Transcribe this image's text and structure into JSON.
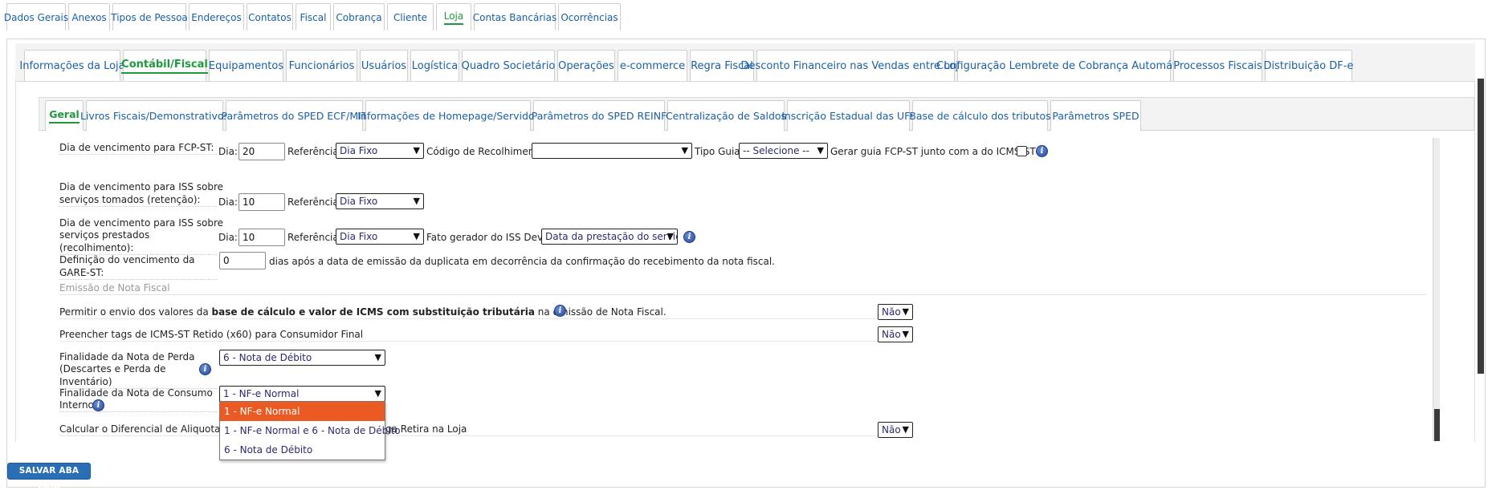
{
  "tabs_level1": [
    {
      "label": "Dados Gerais"
    },
    {
      "label": "Anexos"
    },
    {
      "label": "Tipos de Pessoa"
    },
    {
      "label": "Endereços"
    },
    {
      "label": "Contatos"
    },
    {
      "label": "Fiscal"
    },
    {
      "label": "Cobrança"
    },
    {
      "label": "Cliente"
    },
    {
      "label": "Loja",
      "active": true
    },
    {
      "label": "Contas Bancárias"
    },
    {
      "label": "Ocorrências"
    }
  ],
  "tabs_level2": [
    {
      "label": "Informações da Loja"
    },
    {
      "label": "Contábil/Fiscal",
      "active": true
    },
    {
      "label": "Equipamentos"
    },
    {
      "label": "Funcionários"
    },
    {
      "label": "Usuários"
    },
    {
      "label": "Logística"
    },
    {
      "label": "Quadro Societário"
    },
    {
      "label": "Operações"
    },
    {
      "label": "e-commerce"
    },
    {
      "label": "Regra Fiscal"
    },
    {
      "label": "Desconto Financeiro nas Vendas entre Lojas"
    },
    {
      "label": "Configuração Lembrete de Cobrança Automático"
    },
    {
      "label": "Processos Fiscais"
    },
    {
      "label": "Distribuição DF-e"
    }
  ],
  "tabs_level3": [
    {
      "label": "Geral",
      "active": true
    },
    {
      "label": "Livros Fiscais/Demonstrativos"
    },
    {
      "label": "Parâmetros do SPED ECF/MIT"
    },
    {
      "label": "Informações de Homepage/Servidor"
    },
    {
      "label": "Parâmetros do SPED REINF"
    },
    {
      "label": "Centralização de Saldos"
    },
    {
      "label": "Inscrição Estadual das UFs"
    },
    {
      "label": "Base de cálculo dos tributos"
    },
    {
      "label": "Parâmetros SPED"
    }
  ],
  "form": {
    "fcp": {
      "label": "Dia de vencimento para FCP-ST:",
      "dia_label": "Dia:",
      "dia_value": "20",
      "ref_label": "Referência:",
      "ref_value": "Dia Fixo",
      "codigo_label": "Código de Recolhimento:",
      "codigo_value": "",
      "tipo_guia_label": "Tipo Guia:",
      "tipo_guia_value": "-- Selecione --",
      "gerar_guia_label": "Gerar guia FCP-ST junto com a do ICMS-ST ?"
    },
    "iss_tomados": {
      "label_line1": "Dia de vencimento para ISS sobre",
      "label_line2": "serviços tomados (retenção):",
      "dia_label": "Dia:",
      "dia_value": "10",
      "ref_label": "Referência:",
      "ref_value": "Dia Fixo"
    },
    "iss_prestados": {
      "label_line1": "Dia de vencimento para ISS sobre",
      "label_line2": "serviços prestados (recolhimento):",
      "dia_label": "Dia:",
      "dia_value": "10",
      "ref_label": "Referência:",
      "ref_value": "Dia Fixo",
      "fato_label": "Fato gerador do ISS Devido:",
      "fato_value": "Data da prestação do serviço"
    },
    "gare": {
      "label": "Definição do vencimento da GARE-ST:",
      "value": "0",
      "suffix": "dias após a data de emissão da duplicata em decorrência da confirmação do recebimento da nota fiscal."
    },
    "section_title": "Emissão de Nota Fiscal",
    "permitir": {
      "text_before": "Permitir o envio dos valores da ",
      "text_bold": "base de cálculo e valor de ICMS com substituição tributária",
      "text_after": " na emissão de Nota Fiscal.",
      "value": "Não"
    },
    "preencher": {
      "label": "Preencher tags de ICMS-ST Retido (x60) para Consumidor Final",
      "value": "Não"
    },
    "finalidade_perda": {
      "label_line1": "Finalidade da Nota de Perda",
      "label_line2": "(Descartes e Perda de Inventário)",
      "value": "6 - Nota de Débito"
    },
    "finalidade_consumo": {
      "label_line1": "Finalidade da Nota de Consumo",
      "label_line2": "Interno",
      "value": "1 - NF-e Normal",
      "options": [
        "1 - NF-e Normal",
        "1 - NF-e Normal e 6 - Nota de Débito",
        "6 - Nota de Débito"
      ]
    },
    "calcular": {
      "label_left": "Calcular o Diferencial de Aliquota e FCP",
      "label_right": "ga Retira na Loja",
      "value": "Não"
    }
  },
  "save_button": "SALVAR ABA LOJA",
  "colors": {
    "link": "#1a5fa6",
    "active_tab": "#1d9a3d",
    "dropdown_selected": "#ec5a24",
    "save_button": "#2a6fb5"
  }
}
